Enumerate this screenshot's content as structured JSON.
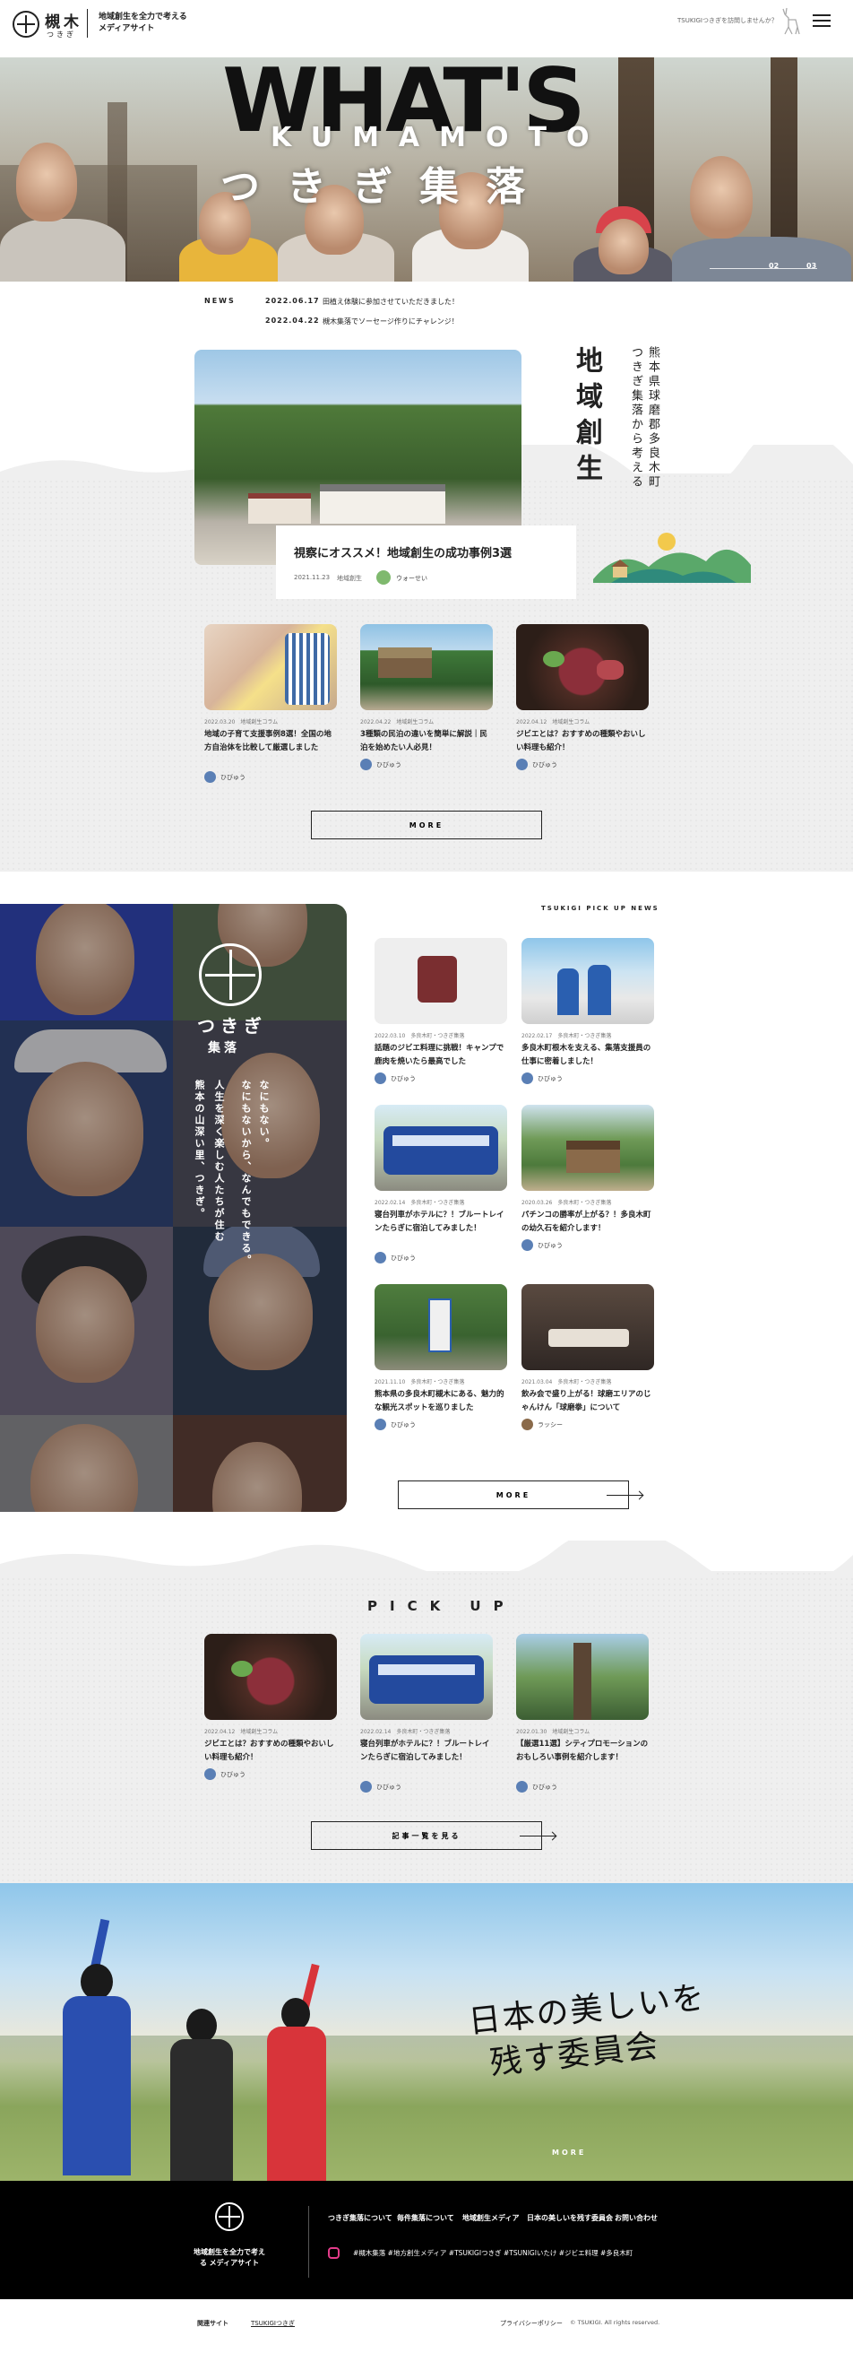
{
  "header": {
    "logo_kanji": "槻木",
    "logo_kana": "つきぎ",
    "tagline": "地域創生を全力で考える メディアサイト",
    "note": "TSUKIGIつきぎを訪問しませんか？"
  },
  "hero": {
    "title": "WHAT'S",
    "subtitle": "KUMAMOTO",
    "title_jp": "つきぎ集落",
    "page_current": "02",
    "page_total": "03"
  },
  "news": {
    "label": "NEWS",
    "items": [
      {
        "date": "2022.06.17",
        "text": "田植え体験に参加させていただきました！"
      },
      {
        "date": "2022.04.22",
        "text": "槻木集落でソーセージ作りにチャレンジ！"
      }
    ]
  },
  "featured": {
    "title": "視察にオススメ！地域創生の成功事例3選",
    "date": "2021.11.23",
    "category": "地域創生",
    "author": "ウォーせい",
    "heading": "地域創生",
    "sub1": "熊本県球磨郡多良木町",
    "sub2": "つきぎ集落から考える"
  },
  "articles": [
    {
      "date": "2022.03.20",
      "category": "地域創生コラム",
      "title": "地域の子育て支援事例8選！全国の地方自治体を比較して厳選しました",
      "author": "ひびゅう"
    },
    {
      "date": "2022.04.22",
      "category": "地域創生コラム",
      "title": "3種類の民泊の違いを簡単に解説｜民泊を始めたい人必見！",
      "author": "ひびゅう"
    },
    {
      "date": "2022.04.12",
      "category": "地域創生コラム",
      "title": "ジビエとは？おすすめの種類やおいしい料理も紹介！",
      "author": "ひびゅう"
    }
  ],
  "more_label": "MORE",
  "tsukigi": {
    "name": "つきぎ",
    "sub": "集落",
    "poem_a": "なにもない。",
    "poem_b": "なにもないから、なんでもできる。",
    "poem_c": "人生を深く楽しむ人たちが住む",
    "poem_d": "熊本の山深い里、つきぎ。"
  },
  "pick_news": {
    "label": "TSUKIGI PICK UP NEWS",
    "items": [
      {
        "date": "2022.03.10",
        "category": "多良木町・つきぎ集落",
        "title": "話題のジビエ料理に挑戦！キャンプで鹿肉を焼いたら最高でした",
        "author": "ひびゅう"
      },
      {
        "date": "2022.02.17",
        "category": "多良木町・つきぎ集落",
        "title": "多良木町根木を支える、集落支援員の仕事に密着しました！",
        "author": "ひびゅう"
      },
      {
        "date": "2022.02.14",
        "category": "多良木町・つきぎ集落",
        "title": "寝台列車がホテルに？！ブルートレインたらぎに宿泊してみました！",
        "author": "ひびゅう"
      },
      {
        "date": "2020.03.26",
        "category": "多良木町・つきぎ集落",
        "title": "パチンコの勝率が上がる？！多良木町の幼久石を紹介します！",
        "author": "ひびゅう"
      },
      {
        "date": "2021.11.10",
        "category": "多良木町・つきぎ集落",
        "title": "熊本県の多良木町槻木にある、魅力的な観光スポットを巡りました",
        "author": "ひびゅう"
      },
      {
        "date": "2021.03.04",
        "category": "多良木町・つきぎ集落",
        "title": "飲み会で盛り上がる！球磨エリアのじゃんけん「球磨拳」について",
        "author": "ラッシー"
      }
    ]
  },
  "pickup": {
    "title": "PICK UP",
    "items": [
      {
        "date": "2022.04.12",
        "category": "地域創生コラム",
        "title": "ジビエとは？おすすめの種類やおいしい料理も紹介！",
        "author": "ひびゅう"
      },
      {
        "date": "2022.02.14",
        "category": "多良木町・つきぎ集落",
        "title": "寝台列車がホテルに？！ブルートレインたらぎに宿泊してみました！",
        "author": "ひびゅう"
      },
      {
        "date": "2022.01.30",
        "category": "地域創生コラム",
        "title": "【厳選11選】シティプロモーションのおもしろい事例を紹介します！",
        "author": "ひびゅう"
      }
    ],
    "all_label": "記事一覧を見る"
  },
  "banner": {
    "line1": "日本の美しいを",
    "line2": "残す委員会",
    "more": "MORE"
  },
  "footer": {
    "tagline": "地域創生を全力で考える メディアサイト",
    "nav": [
      "つきぎ集落について",
      "毎件集落について",
      "地域創生メディア",
      "日本の美しいを残す委員会",
      "お問い合わせ"
    ],
    "tags": "#槻木集落 #地方創生メディア #TSUKIGIつきぎ #TSUNIGIいたけ #ジビエ料理 #多良木町",
    "related_label": "関連サイト",
    "related_link": "TSUKIGIつきぎ",
    "privacy": "プライバシーポリシー",
    "copyright": "© TSUKIGI. All rights reserved."
  },
  "colors": {
    "accent_green": "#5aa86a",
    "footer_bg": "#000000",
    "paper": "#efefef",
    "insta": "#e33c8a"
  }
}
